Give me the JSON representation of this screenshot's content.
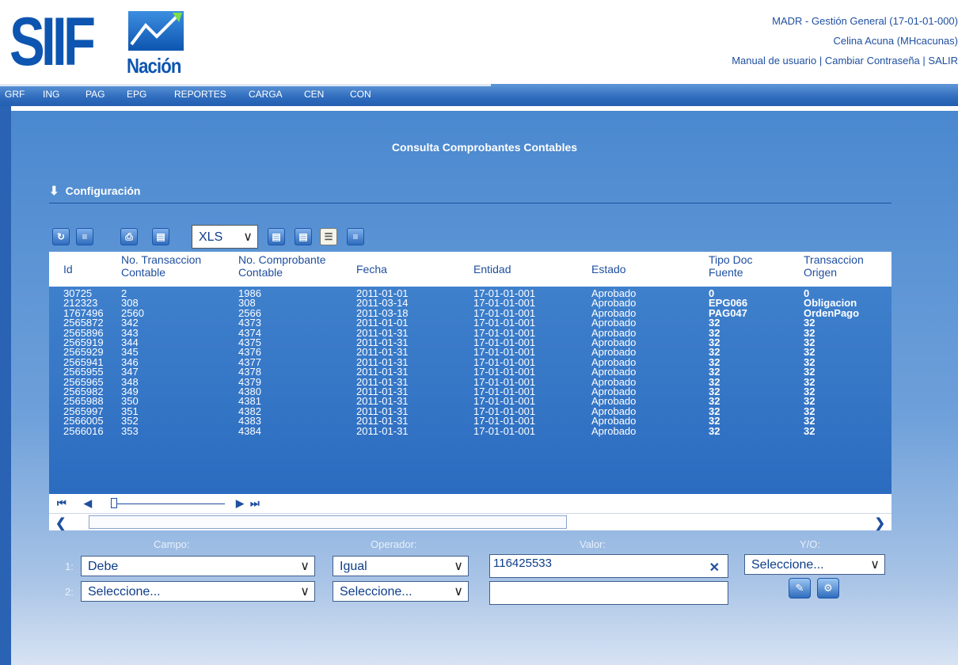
{
  "header": {
    "logo_text": "SIIF",
    "logo_sub": "Nación",
    "entity": "MADR - Gestión General (17-01-01-000)",
    "user": "Celina Acuna (MHcacunas)",
    "links": {
      "manual": "Manual de usuario",
      "sep": "|",
      "change_password": "Cambiar Contraseña",
      "exit": "SALIR"
    }
  },
  "menu": [
    "GRF",
    "ING",
    "PAG",
    "EPG",
    "REPORTES",
    "CARGA",
    "CEN",
    "CON"
  ],
  "page_title": "Consulta Comprobantes Contables",
  "config_label": "Configuración",
  "toolbar": {
    "format": "XLS"
  },
  "table": {
    "columns": [
      {
        "l1": "Id",
        "l2": ""
      },
      {
        "l1": "No. Transaccion",
        "l2": "Contable"
      },
      {
        "l1": "No. Comprobante",
        "l2": "Contable"
      },
      {
        "l1": "Fecha",
        "l2": ""
      },
      {
        "l1": "Entidad",
        "l2": ""
      },
      {
        "l1": "Estado",
        "l2": ""
      },
      {
        "l1": "Tipo Doc",
        "l2": "Fuente"
      },
      {
        "l1": "Transaccion",
        "l2": "Origen"
      }
    ],
    "rows": [
      [
        "30725",
        "2",
        "1986",
        "2011-01-01",
        "17-01-01-001",
        "Aprobado",
        "0",
        "0"
      ],
      [
        "212323",
        "308",
        "308",
        "2011-03-14",
        "17-01-01-001",
        "Aprobado",
        "EPG066",
        "Obligacion"
      ],
      [
        "1767496",
        "2560",
        "2566",
        "2011-03-18",
        "17-01-01-001",
        "Aprobado",
        "PAG047",
        "OrdenPago"
      ],
      [
        "2565872",
        "342",
        "4373",
        "2011-01-01",
        "17-01-01-001",
        "Aprobado",
        "32",
        "32"
      ],
      [
        "2565896",
        "343",
        "4374",
        "2011-01-31",
        "17-01-01-001",
        "Aprobado",
        "32",
        "32"
      ],
      [
        "2565919",
        "344",
        "4375",
        "2011-01-31",
        "17-01-01-001",
        "Aprobado",
        "32",
        "32"
      ],
      [
        "2565929",
        "345",
        "4376",
        "2011-01-31",
        "17-01-01-001",
        "Aprobado",
        "32",
        "32"
      ],
      [
        "2565941",
        "346",
        "4377",
        "2011-01-31",
        "17-01-01-001",
        "Aprobado",
        "32",
        "32"
      ],
      [
        "2565955",
        "347",
        "4378",
        "2011-01-31",
        "17-01-01-001",
        "Aprobado",
        "32",
        "32"
      ],
      [
        "2565965",
        "348",
        "4379",
        "2011-01-31",
        "17-01-01-001",
        "Aprobado",
        "32",
        "32"
      ],
      [
        "2565982",
        "349",
        "4380",
        "2011-01-31",
        "17-01-01-001",
        "Aprobado",
        "32",
        "32"
      ],
      [
        "2565988",
        "350",
        "4381",
        "2011-01-31",
        "17-01-01-001",
        "Aprobado",
        "32",
        "32"
      ],
      [
        "2565997",
        "351",
        "4382",
        "2011-01-31",
        "17-01-01-001",
        "Aprobado",
        "32",
        "32"
      ],
      [
        "2566005",
        "352",
        "4383",
        "2011-01-31",
        "17-01-01-001",
        "Aprobado",
        "32",
        "32"
      ],
      [
        "2566016",
        "353",
        "4384",
        "2011-01-31",
        "17-01-01-001",
        "Aprobado",
        "32",
        "32"
      ]
    ]
  },
  "filter": {
    "labels": {
      "campo": "Campo:",
      "operador": "Operador:",
      "valor": "Valor:",
      "yo": "Y/O:"
    },
    "rows": [
      {
        "num": "1:",
        "campo": "Debe",
        "operador": "Igual",
        "valor": "116425533",
        "yo": "Seleccione..."
      },
      {
        "num": "2:",
        "campo": "Seleccione...",
        "operador": "Seleccione...",
        "valor": "",
        "yo": ""
      }
    ]
  }
}
